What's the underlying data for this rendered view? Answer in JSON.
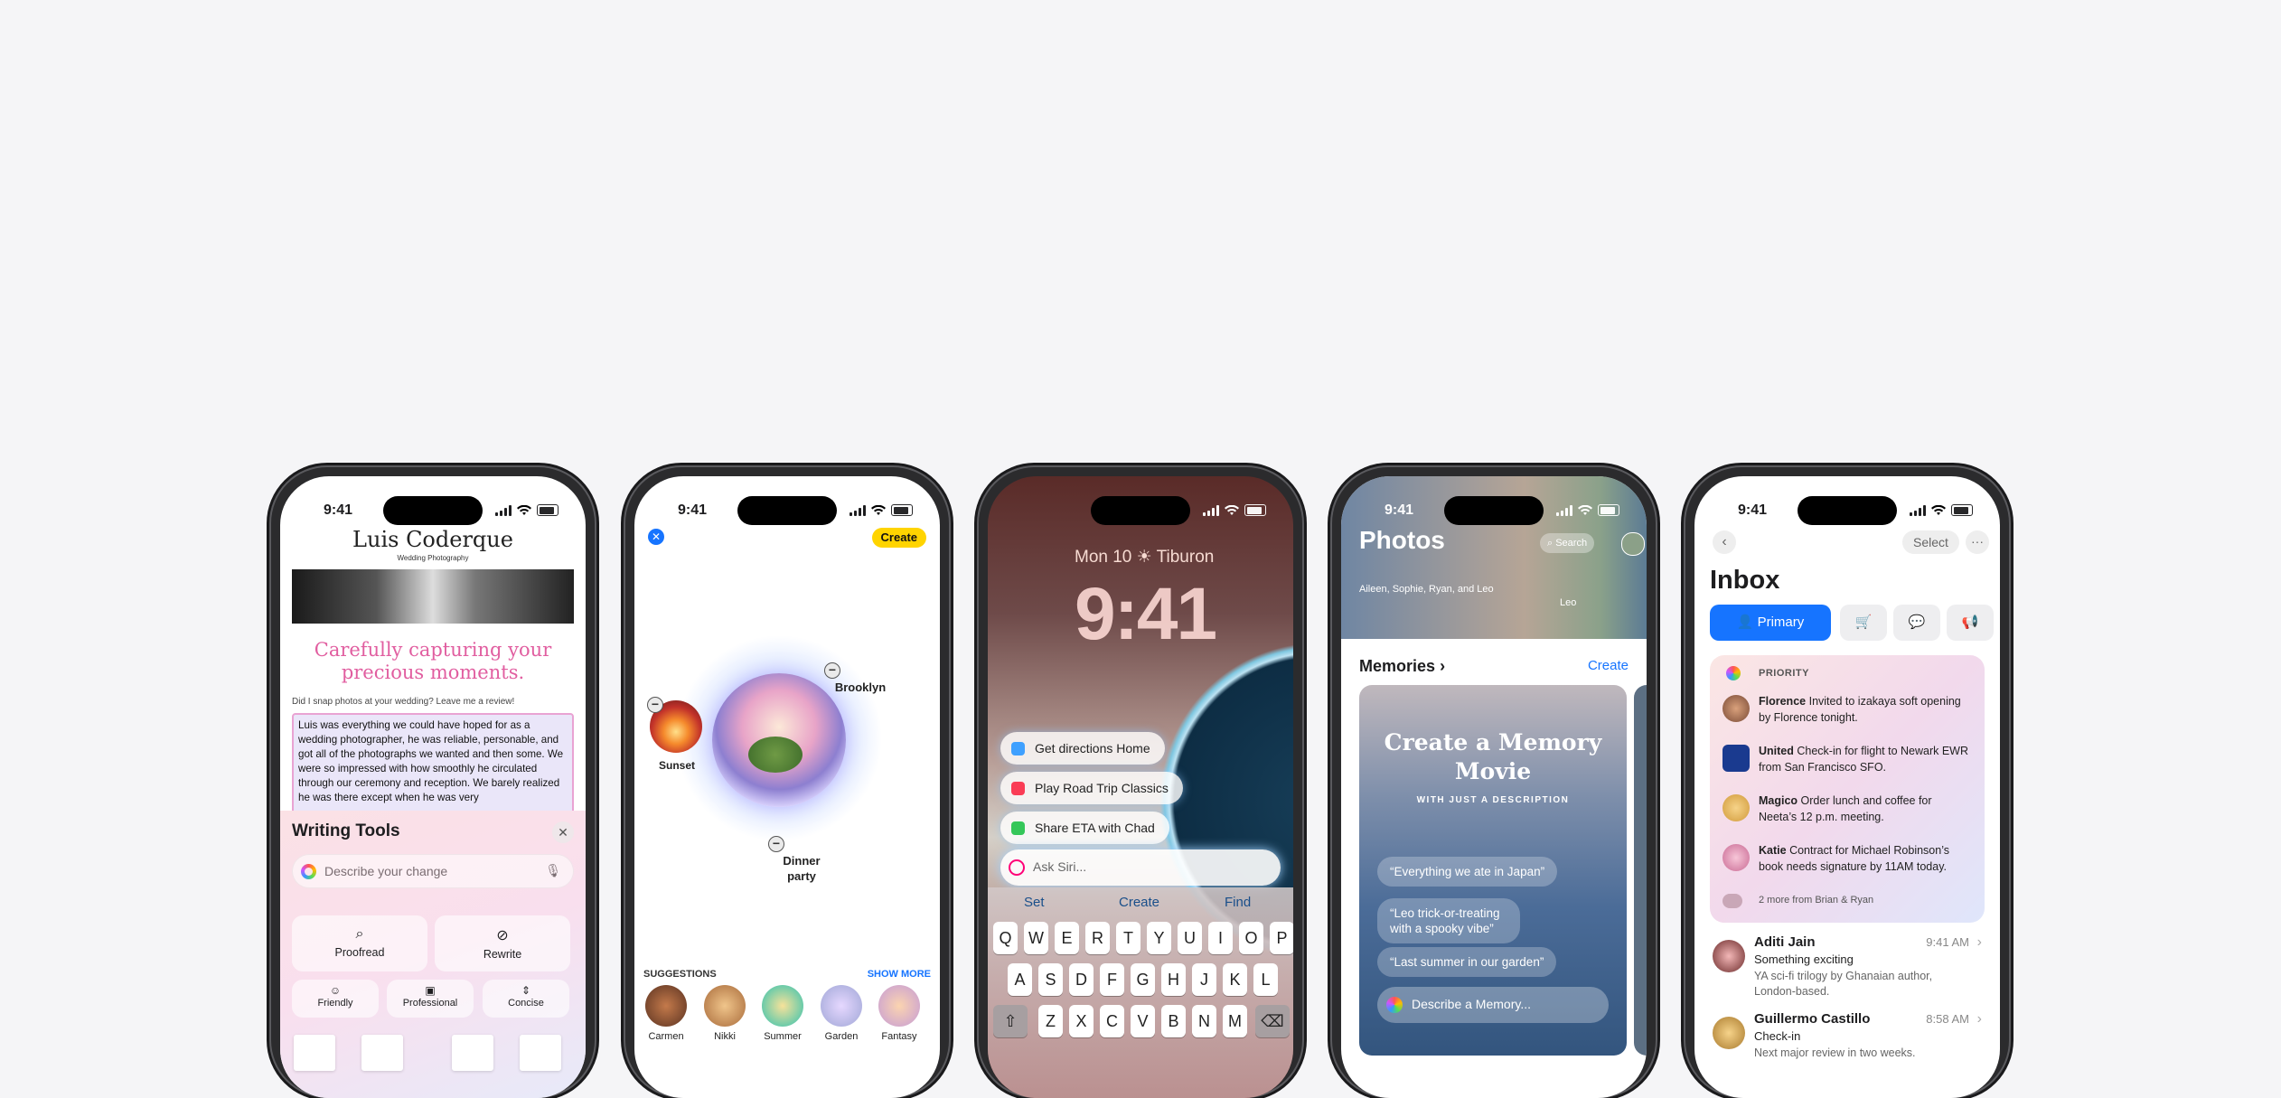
{
  "status_time": "9:41",
  "phone1": {
    "brand": "Luis Coderque",
    "brand_sub": "Wedding Photography",
    "heading": "Carefully capturing your precious moments.",
    "prompt": "Did I snap photos at your wedding? Leave me a review!",
    "review": "Luis was everything we could have hoped for as a wedding photographer, he was reliable, personable, and got all of the photographs we wanted and then some. We were so impressed with how smoothly he circulated through our ceremony and reception. We barely realized he was there except when he was very",
    "writing_tools_title": "Writing Tools",
    "describe_placeholder": "Describe your change",
    "tools": {
      "proofread": "Proofread",
      "rewrite": "Rewrite",
      "friendly": "Friendly",
      "professional": "Professional",
      "concise": "Concise"
    }
  },
  "phone2": {
    "create_label": "Create",
    "concepts": {
      "brooklyn": "Brooklyn",
      "sunset": "Sunset",
      "dinner": "Dinner party"
    },
    "suggestions_header": "SUGGESTIONS",
    "show_more": "SHOW MORE",
    "suggestions": [
      "Carmen",
      "Nikki",
      "Summer",
      "Garden",
      "Fantasy"
    ]
  },
  "phone3": {
    "date": "Mon 10 ☀ Tiburon",
    "clock": "9:41",
    "pills": [
      "Get directions Home",
      "Play Road Trip Classics",
      "Share ETA with Chad"
    ],
    "siri_placeholder": "Ask Siri...",
    "keyboard_suggestions": [
      "Set",
      "Create",
      "Find"
    ],
    "row1": [
      "Q",
      "W",
      "E",
      "R",
      "T",
      "Y",
      "U",
      "I",
      "O",
      "P"
    ],
    "row2": [
      "A",
      "S",
      "D",
      "F",
      "G",
      "H",
      "J",
      "K",
      "L"
    ],
    "row3": [
      "Z",
      "X",
      "C",
      "V",
      "B",
      "N",
      "M"
    ]
  },
  "phone4": {
    "title": "Photos",
    "search": "Search",
    "people": "Aileen, Sophie, Ryan, and Leo",
    "leo": "Leo",
    "memories": "Memories",
    "create": "Create",
    "card_title": "Create a Memory Movie",
    "card_sub": "WITH JUST A DESCRIPTION",
    "prompts": [
      "“Everything we ate in Japan”",
      "“Leo trick-or-treating with a spooky vibe”",
      "“Last summer in our garden”"
    ],
    "describe_placeholder": "Describe a Memory..."
  },
  "phone5": {
    "select": "Select",
    "inbox": "Inbox",
    "primary": "Primary",
    "priority": "PRIORITY",
    "priority_items": [
      {
        "name": "Florence",
        "text": "Invited to izakaya soft opening by Florence tonight."
      },
      {
        "name": "United",
        "text": "Check-in for flight to Newark EWR from San Francisco SFO."
      },
      {
        "name": "Magico",
        "text": "Order lunch and coffee for Neeta’s 12 p.m. meeting."
      },
      {
        "name": "Katie",
        "text": "Contract for Michael Robinson’s book needs signature by 11AM today."
      }
    ],
    "more_from": "2 more from Brian & Ryan",
    "mails": [
      {
        "name": "Aditi Jain",
        "time": "9:41 AM",
        "subject": "Something exciting",
        "preview": "YA sci-fi trilogy by Ghanaian author, London-based."
      },
      {
        "name": "Guillermo Castillo",
        "time": "8:58 AM",
        "subject": "Check-in",
        "preview": "Next major review in two weeks."
      }
    ]
  }
}
